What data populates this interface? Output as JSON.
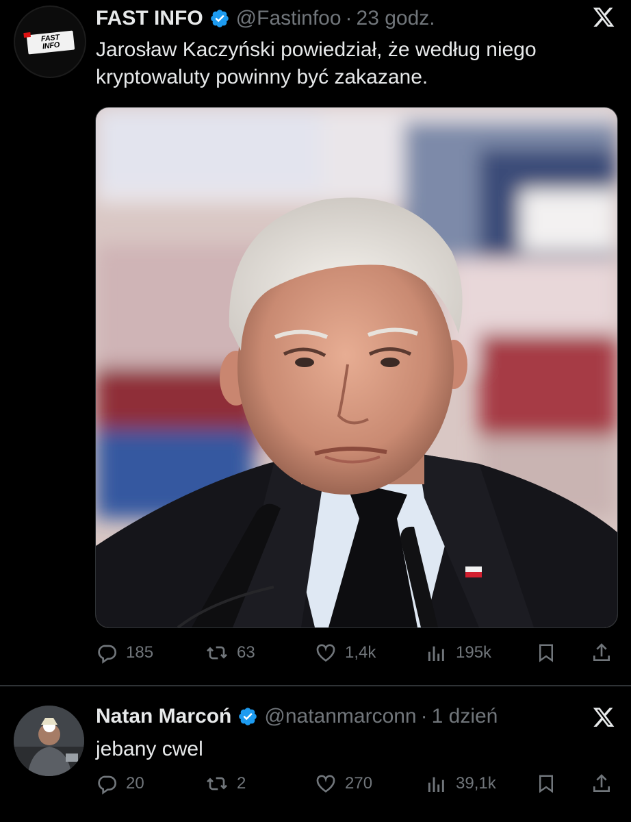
{
  "tweets": [
    {
      "author": {
        "name": "FAST INFO",
        "handle": "@Fastinfoo",
        "avatar_text": "FAST\nINFO"
      },
      "time": "23 godz.",
      "separator": "·",
      "text": "Jarosław Kaczyński powiedział, że według niego\nkryptowaluty powinny być zakazane.",
      "stats": {
        "replies": "185",
        "reposts": "63",
        "likes": "1,4k",
        "views": "195k"
      }
    },
    {
      "author": {
        "name": "Natan Marcoń",
        "handle": "@natanmarconn"
      },
      "time": "1 dzień",
      "separator": "·",
      "text": "jebany cwel",
      "stats": {
        "replies": "20",
        "reposts": "2",
        "likes": "270",
        "views": "39,1k"
      }
    }
  ],
  "colors": {
    "background": "#000000",
    "text": "#e7e9ea",
    "muted": "#71767b",
    "verified": "#1d9bf0",
    "divider": "#2f3336"
  },
  "icons": [
    "verified-badge-icon",
    "x-logo-icon",
    "reply-icon",
    "repost-icon",
    "like-icon",
    "views-icon",
    "bookmark-icon",
    "share-icon"
  ]
}
